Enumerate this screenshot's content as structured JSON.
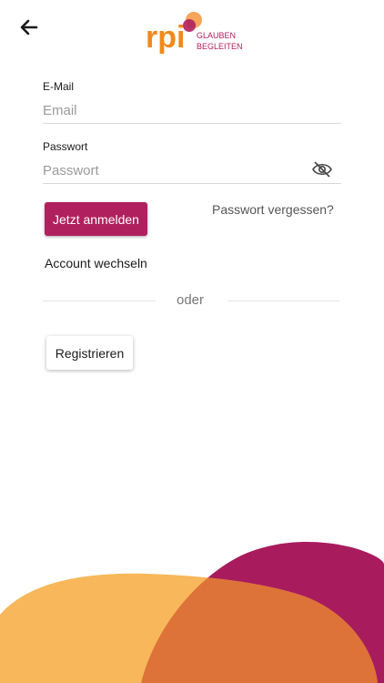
{
  "header": {
    "back_icon": "arrow-left-icon",
    "logo": {
      "mark": "rpi",
      "tagline_line1": "GLAUBEN",
      "tagline_line2": "BEGLEITEN",
      "colors": {
        "orange": "#f08a1c",
        "magenta": "#b0205e",
        "peach": "#f6a55a"
      }
    }
  },
  "form": {
    "email": {
      "label": "E-Mail",
      "placeholder": "Email",
      "value": ""
    },
    "password": {
      "label": "Passwort",
      "placeholder": "Passwort",
      "value": "",
      "toggle_icon": "eye-off-icon"
    },
    "submit_label": "Jetzt anmelden",
    "forgot_label": "Passwort vergessen?",
    "switch_account_label": "Account wechseln",
    "divider_text": "oder",
    "register_label": "Registrieren"
  },
  "theme": {
    "primary": "#b0205e",
    "blob_peach": "#f7b75a",
    "blob_magenta": "#a81c5e",
    "blob_overlap": "#dd7338"
  }
}
